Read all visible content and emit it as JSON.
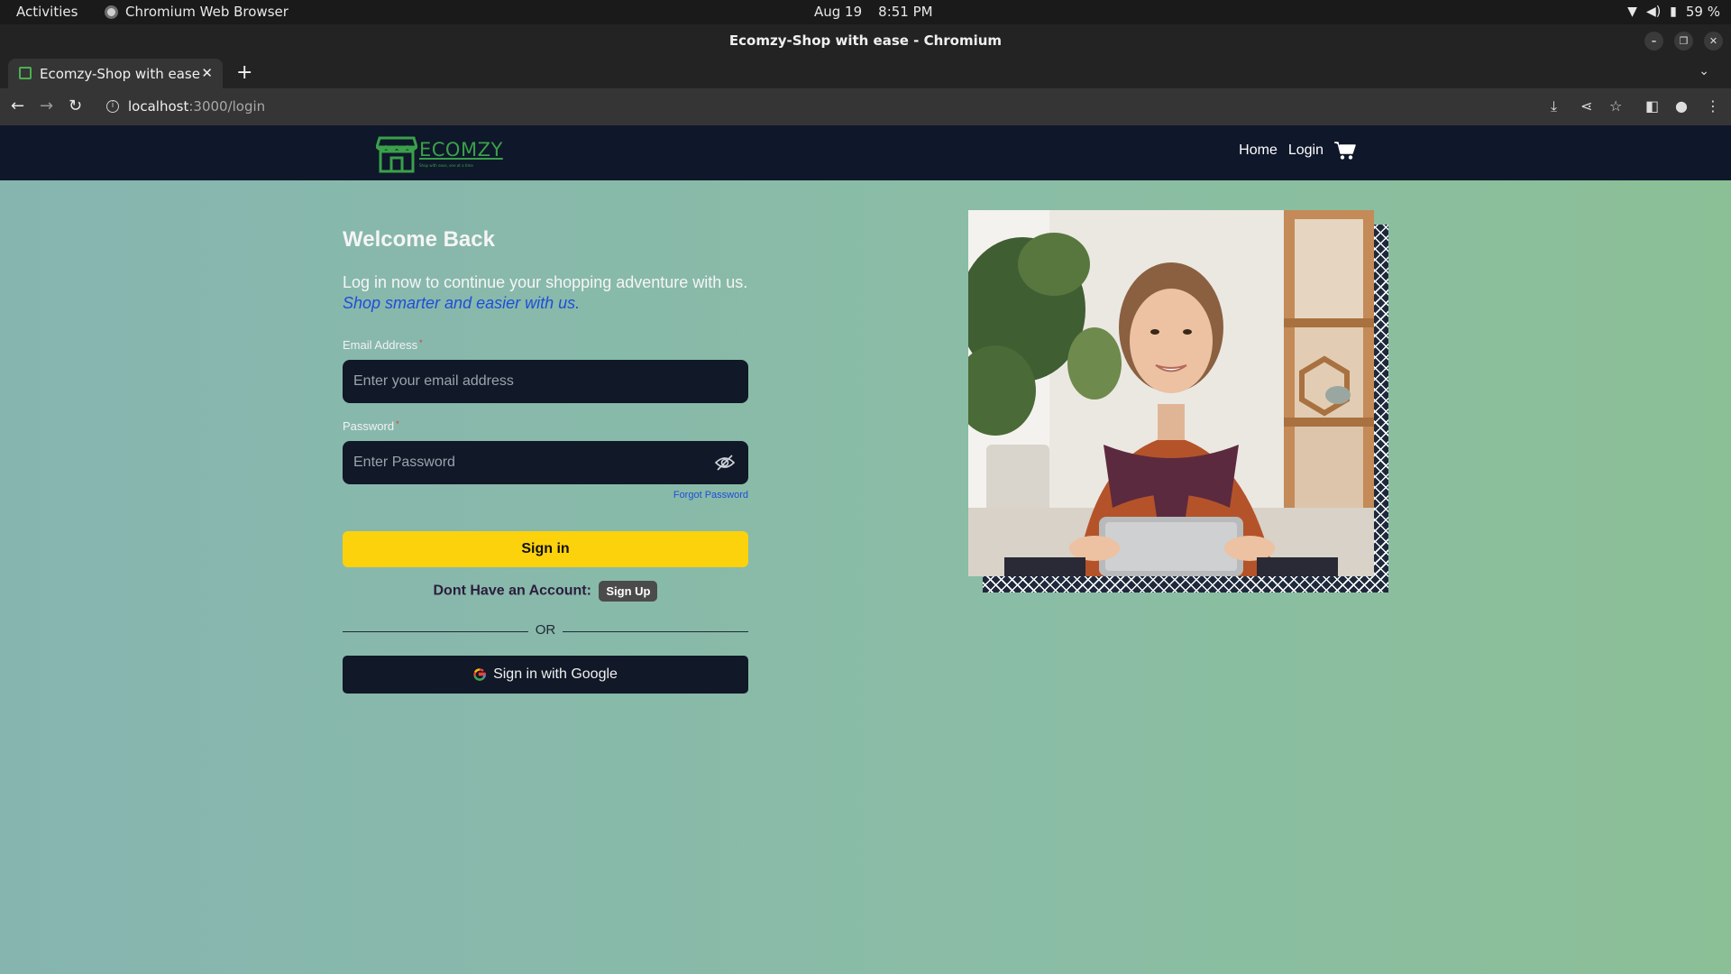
{
  "os": {
    "activities": "Activities",
    "app_name": "Chromium Web Browser",
    "date": "Aug 19",
    "time": "8:51 PM",
    "battery": "59 %"
  },
  "browser": {
    "window_title": "Ecomzy-Shop with ease - Chromium",
    "tab_title": "Ecomzy-Shop with ease",
    "url_host": "localhost",
    "url_path": ":3000/login"
  },
  "navbar": {
    "brand": "ECOMZY",
    "tagline": "Shop with ease, one at a time",
    "links": [
      "Home",
      "Login"
    ]
  },
  "login": {
    "heading": "Welcome Back",
    "subtitle": "Log in now to continue your shopping adventure with us.",
    "subtitle_accent": "Shop smarter and easier with us.",
    "email_label": "Email Address",
    "email_placeholder": "Enter your email address",
    "password_label": "Password",
    "password_placeholder": "Enter Password",
    "required_mark": "*",
    "forgot": "Forgot Password",
    "signin": "Sign in",
    "no_account": "Dont Have an Account:",
    "signup": "Sign Up",
    "or": "OR",
    "google": "Sign in with Google"
  },
  "colors": {
    "navbar_bg": "#0f172a",
    "brand_green": "#3aa04a",
    "signin_yellow": "#fcd20c",
    "accent_blue": "#1d4ed8",
    "input_bg": "#111827"
  },
  "icons": [
    "cart-icon",
    "eye-slash-icon",
    "google-icon",
    "store-logo-icon"
  ]
}
